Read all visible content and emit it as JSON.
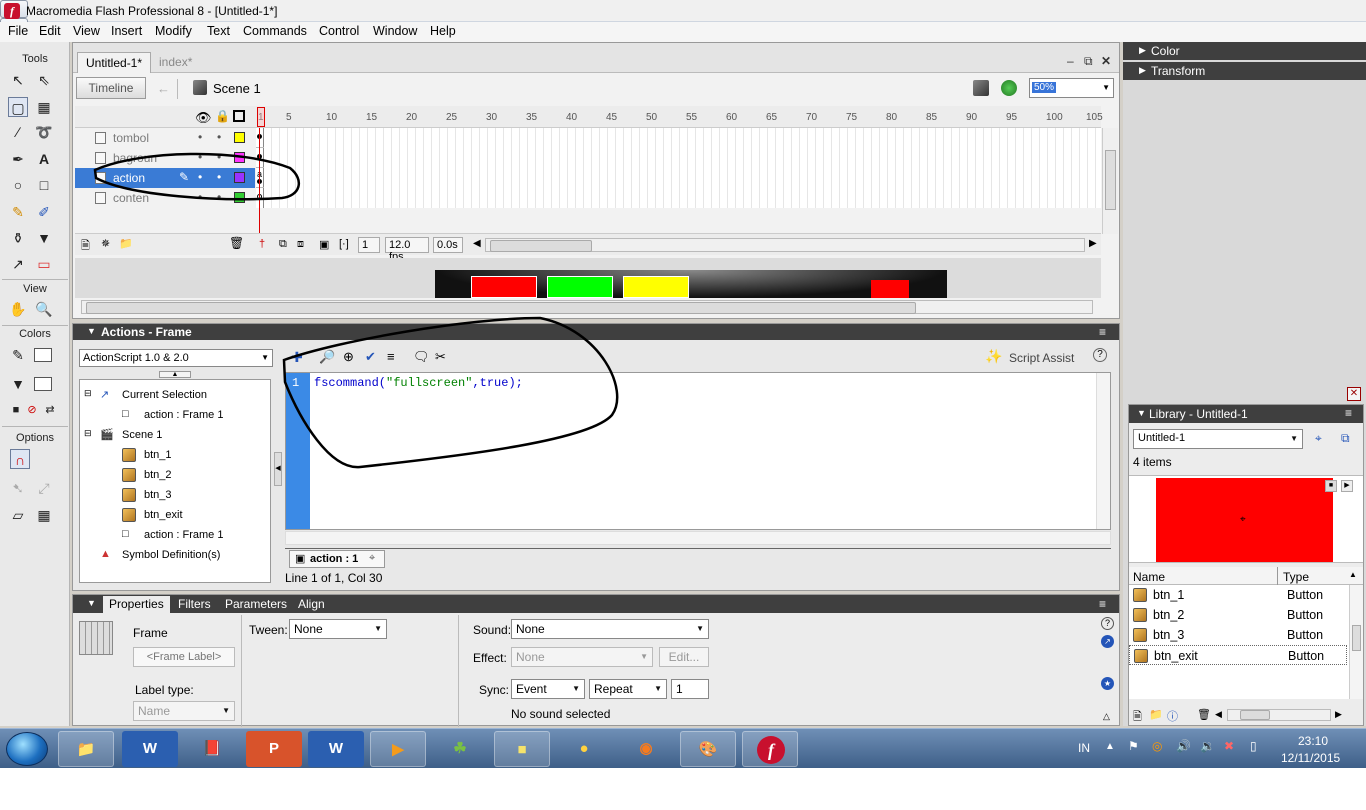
{
  "window": {
    "title": "Macromedia Flash Professional 8 - [Untitled-1*]",
    "controls": {
      "minimize": "–",
      "restore": "⧉",
      "close": "✕"
    }
  },
  "menu": [
    "File",
    "Edit",
    "View",
    "Insert",
    "Modify",
    "Text",
    "Commands",
    "Control",
    "Window",
    "Help"
  ],
  "tools": {
    "title": "Tools",
    "view": "View",
    "colors": "Colors",
    "options": "Options"
  },
  "document": {
    "tabs": [
      "Untitled-1*",
      "index*"
    ],
    "timeline_button": "Timeline",
    "scene": "Scene 1",
    "zoom": "50%"
  },
  "timeline": {
    "ruler": [
      "1",
      "5",
      "10",
      "15",
      "20",
      "25",
      "30",
      "35",
      "40",
      "45",
      "50",
      "55",
      "60",
      "65",
      "70",
      "75",
      "80",
      "85",
      "90",
      "95",
      "100",
      "105"
    ],
    "layers": [
      {
        "name": "tombol",
        "color": "#ffff00"
      },
      {
        "name": "bagroun",
        "color": "#ff33ff"
      },
      {
        "name": "action",
        "color": "#9933ff",
        "selected": true
      },
      {
        "name": "conten",
        "color": "#33cc33"
      }
    ],
    "current_frame": "1",
    "fps": "12.0 fps",
    "time": "0.0s"
  },
  "actions": {
    "title": "Actions - Frame",
    "language": "ActionScript 1.0 & 2.0",
    "script_assist": "Script Assist",
    "tree": {
      "current_selection": "Current Selection",
      "current_frame": "action : Frame 1",
      "scene": "Scene 1",
      "buttons": [
        "btn_1",
        "btn_2",
        "btn_3",
        "btn_exit"
      ],
      "scene_frame": "action : Frame 1",
      "symbols": "Symbol Definition(s)"
    },
    "code": {
      "line_number": "1",
      "func": "fscommand(",
      "arg": "\"fullscreen\"",
      "rest": ",true);"
    },
    "tab": "action : 1",
    "status": "Line 1 of 1, Col 30"
  },
  "properties": {
    "tabs": [
      "Properties",
      "Filters",
      "Parameters",
      "Align"
    ],
    "frame_label": "Frame",
    "frame_placeholder": "<Frame Label>",
    "tween_label": "Tween:",
    "tween_value": "None",
    "sound_label": "Sound:",
    "sound_value": "None",
    "effect_label": "Effect:",
    "effect_value": "None",
    "edit_button": "Edit...",
    "label_type_label": "Label type:",
    "label_type_value": "Name",
    "sync_label": "Sync:",
    "sync_value": "Event",
    "repeat_value": "Repeat",
    "repeat_count": "1",
    "sound_status": "No sound selected"
  },
  "right_panels": {
    "color": "Color",
    "transform": "Transform"
  },
  "library": {
    "title": "Library - Untitled-1",
    "document": "Untitled-1",
    "count": "4 items",
    "col_name": "Name",
    "col_type": "Type",
    "items": [
      {
        "name": "btn_1",
        "type": "Button"
      },
      {
        "name": "btn_2",
        "type": "Button"
      },
      {
        "name": "btn_3",
        "type": "Button"
      },
      {
        "name": "btn_exit",
        "type": "Button"
      }
    ]
  },
  "taskbar": {
    "apps": [
      "explorer",
      "word",
      "reader",
      "powerpoint",
      "word-2",
      "media",
      "app",
      "notes",
      "chrome",
      "firefox",
      "paint",
      "flash"
    ],
    "language": "IN",
    "time": "23:10",
    "date": "12/11/2015"
  },
  "colors": {
    "accent": "#3a7bd5",
    "panel_header": "#3f3f3f",
    "gutter": "#3b8ae6"
  }
}
